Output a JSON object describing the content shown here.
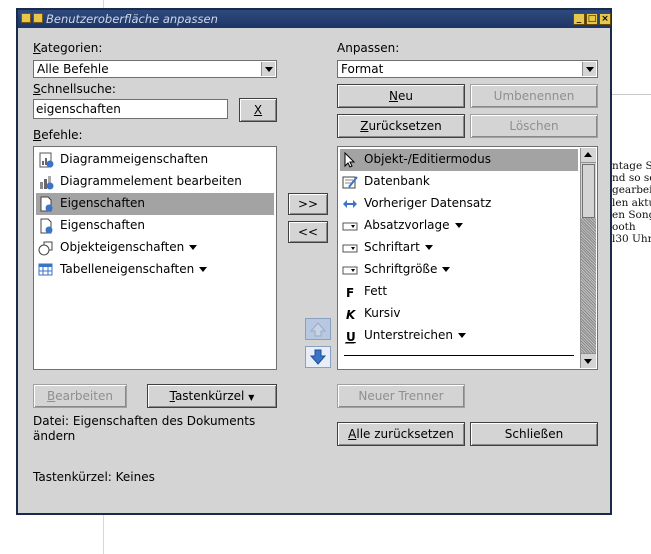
{
  "window": {
    "title": "Benutzeroberfläche anpassen"
  },
  "background_doc": {
    "lines": [
      "ntage So",
      "nd so sc",
      "gearbei",
      "len aktu",
      "en Song",
      "ooth",
      "l30 Uhr"
    ]
  },
  "left": {
    "categories_label": "Kategorien:",
    "categories_value": "Alle Befehle",
    "quicksearch_label": "Schnellsuche:",
    "quicksearch_value": "eigenschaften",
    "clear_label": "X",
    "commands_label": "Befehle:",
    "commands": [
      {
        "label": "Diagrammeigenschaften",
        "icon": "chart-properties-icon",
        "dropdown": false
      },
      {
        "label": "Diagrammelement bearbeiten",
        "icon": "chart-element-icon",
        "dropdown": false
      },
      {
        "label": "Eigenschaften",
        "icon": "document-properties-icon",
        "dropdown": false,
        "selected": true
      },
      {
        "label": "Eigenschaften",
        "icon": "document-properties-icon",
        "dropdown": false
      },
      {
        "label": "Objekteigenschaften",
        "icon": "object-properties-icon",
        "dropdown": true
      },
      {
        "label": "Tabelleneigenschaften",
        "icon": "table-properties-icon",
        "dropdown": true
      }
    ],
    "edit_button": "Bearbeiten",
    "shortcut_button": "Tastenkürzel",
    "file_info": "Datei: Eigenschaften des Dokuments ändern",
    "shortcut_info": "Tastenkürzel: Keines"
  },
  "middle": {
    "add": ">>",
    "remove": "<<"
  },
  "right": {
    "customize_label": "Anpassen:",
    "customize_value": "Format",
    "new_button": "Neu",
    "rename_button": "Umbenennen",
    "reset_button": "Zurücksetzen",
    "delete_button": "Löschen",
    "items": [
      {
        "label": "Objekt-/Editiermodus",
        "icon": "cursor-icon",
        "dropdown": false,
        "selected": true
      },
      {
        "label": "Datenbank",
        "icon": "database-icon",
        "dropdown": false
      },
      {
        "label": "Vorheriger Datensatz",
        "icon": "double-arrow-icon",
        "dropdown": false
      },
      {
        "label": "Absatzvorlage",
        "icon": "combo-icon",
        "dropdown": true
      },
      {
        "label": "Schriftart",
        "icon": "combo-icon",
        "dropdown": true
      },
      {
        "label": "Schriftgröße",
        "icon": "combo-icon",
        "dropdown": true
      },
      {
        "label": "Fett",
        "icon": "bold-icon",
        "glyph": "F",
        "dropdown": false
      },
      {
        "label": "Kursiv",
        "icon": "italic-icon",
        "glyph": "K",
        "dropdown": false
      },
      {
        "label": "Unterstreichen",
        "icon": "underline-icon",
        "glyph": "U",
        "dropdown": true
      }
    ],
    "new_separator_button": "Neuer Trenner",
    "reset_all_button": "Alle zurücksetzen",
    "close_button": "Schließen"
  },
  "colors": {
    "titlebar": "#1e3566",
    "dialog_bg": "#d4d4d4",
    "selection": "#a3a3a3",
    "move_arrow": "#3a73c8"
  }
}
